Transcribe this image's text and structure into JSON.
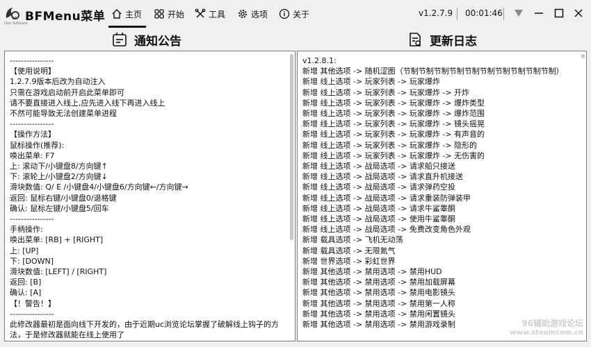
{
  "app": {
    "title": "BFMenu菜单",
    "logo_caption": "Ooo Software",
    "version": "v1.2.7.9",
    "timer": "00:01:46"
  },
  "nav": {
    "home": "主页",
    "start": "开始",
    "tools": "工具",
    "options": "选项",
    "about": "关于"
  },
  "panels": {
    "notice_title": "通知公告",
    "changelog_title": "更新日志"
  },
  "notice_lines": [
    "----------------",
    "【使用说明】",
    "1.2.7.9版本后改为自动注入",
    "只需在游戏启动前开启此菜单即可",
    "请不要直接进入线上,应先进入线下再进入线上",
    "不然可能导致无法创建菜单进程",
    "----------------",
    "【操作方法】",
    "鼠标操作(推荐):",
    "唤出菜单: F7",
    "上: 滚动下/小键盘8/方向键↑",
    "下: 滚轮上/小键盘2/方向键↓",
    "滑块数值: Q/ E /小键盘4/小键盘6/方向键←/方向键→",
    "返回: 鼠标右键/小键盘0/退格键",
    "确认: 鼠标左键/小键盘5/回车",
    "----------------",
    "手柄操作:",
    "唤出菜单: [RB] + [RIGHT]",
    "上: [UP]",
    "下: [DOWN]",
    "滑块数值: [LEFT] / [RIGHT]",
    "返回: [B]",
    "确认: [A]",
    "【！警告！】",
    "----------------",
    "此修改器最初是面向线下开发的，由于近期uc浏览论坛掌握了破解线上钩子的方法，于是修改器就能在线上使用了"
  ],
  "changelog_lines": [
    "v1.2.8.1:",
    "新增 其他选项 -> 随机涩图（节制节制节制节制节制节制节制节制节制节制）",
    "新增 线上选项 -> 玩家列表 -> 玩家爆炸",
    "新增 线上选项 -> 玩家列表 -> 玩家爆炸 -> 开炸",
    "新增 线上选项 -> 玩家列表 -> 玩家爆炸 -> 爆炸类型",
    "新增 线上选项 -> 玩家列表 -> 玩家爆炸 -> 爆炸范围",
    "新增 线上选项 -> 玩家列表 -> 玩家爆炸 -> 镜头摇晃",
    "新增 线上选项 -> 玩家列表 -> 玩家爆炸 -> 有声音的",
    "新增 线上选项 -> 玩家列表 -> 玩家爆炸 -> 隐形的",
    "新增 线上选项 -> 玩家列表 -> 玩家爆炸 -> 无伤害的",
    "新增 线上选项 -> 战局选项 -> 请求船只接送",
    "新增 线上选项 -> 战局选项 -> 请求直升机接送",
    "新增 线上选项 -> 战局选项 -> 请求弹药空投",
    "新增 线上选项 -> 战局选项 -> 请求重装防弹装甲",
    "新增 线上选项 -> 战局选项 -> 请求牛鲨睾酮",
    "新增 线上选项 -> 战局选项 -> 使用牛鲨睾酮",
    "新增 线上选项 -> 战局选项 -> 免费改变角色外观",
    "新增 载具选项 -> 飞机无动荡",
    "新增 载具选项 -> 无限氮气",
    "新增 世界选项 -> 彩虹世界",
    "新增 其他选项 -> 禁用选项 -> 禁用HUD",
    "新增 其他选项 -> 禁用选项 -> 禁用加载屏幕",
    "新增 其他选项 -> 禁用选项 -> 禁用电影镜头",
    "新增 其他选项 -> 禁用选项 -> 禁用第一人称",
    "新增 其他选项 -> 禁用选项 -> 禁用闲置镜头",
    "新增 其他选项 -> 禁用选项 -> 禁用游戏录制"
  ],
  "watermark": {
    "line1": "96辅助游戏论坛",
    "line2": "www.steamcom.cn"
  }
}
